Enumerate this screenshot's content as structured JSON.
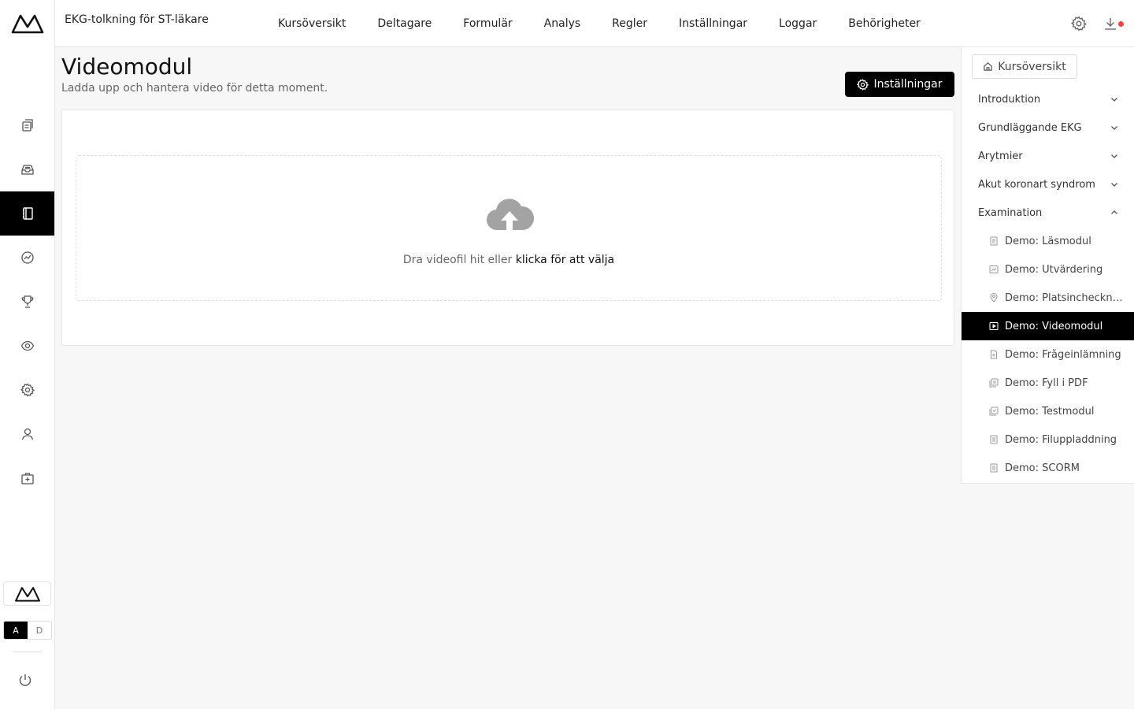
{
  "header": {
    "course_title": "EKG-tolkning för ST-läkare",
    "menu": [
      {
        "label": "Kursöversikt"
      },
      {
        "label": "Deltagare"
      },
      {
        "label": "Formulär"
      },
      {
        "label": "Analys"
      },
      {
        "label": "Regler"
      },
      {
        "label": "Inställningar"
      },
      {
        "label": "Loggar"
      },
      {
        "label": "Behörigheter"
      }
    ],
    "settings_icon": "gear-icon",
    "download_icon": "download-icon",
    "notification_color": "#ef4444"
  },
  "rail": {
    "active_index": 2,
    "items": [
      {
        "icon": "documents-icon"
      },
      {
        "icon": "inbox-icon"
      },
      {
        "icon": "notebook-icon"
      },
      {
        "icon": "analytics-icon"
      },
      {
        "icon": "trophy-icon"
      },
      {
        "icon": "eye-icon"
      },
      {
        "icon": "gear-icon"
      },
      {
        "icon": "user-icon"
      },
      {
        "icon": "medical-kit-icon"
      }
    ],
    "lang_a": "A",
    "lang_d": "D"
  },
  "main": {
    "title": "Videomodul",
    "subtitle": "Ladda upp och hantera video för detta moment.",
    "settings_button": "Inställningar",
    "dropzone_text": "Dra videofil hit eller ",
    "dropzone_link": "klicka för att välja"
  },
  "panel": {
    "overview_button": "Kursöversikt",
    "sections": [
      {
        "label": "Introduktion",
        "expanded": false
      },
      {
        "label": "Grundläggande EKG",
        "expanded": false
      },
      {
        "label": "Arytmier",
        "expanded": false
      },
      {
        "label": "Akut koronart syndrom",
        "expanded": false
      },
      {
        "label": "Examination",
        "expanded": true
      }
    ],
    "items": [
      {
        "label": "Demo: Läsmodul",
        "icon": "document-icon"
      },
      {
        "label": "Demo: Utvärdering",
        "icon": "chart-icon"
      },
      {
        "label": "Demo: Platsincheckning",
        "icon": "location-pin-icon"
      },
      {
        "label": "Demo: Videomodul",
        "icon": "video-icon",
        "active": true
      },
      {
        "label": "Demo: Frågeinlämning",
        "icon": "file-plus-icon"
      },
      {
        "label": "Demo: Fyll i PDF",
        "icon": "pdf-icon"
      },
      {
        "label": "Demo: Testmodul",
        "icon": "test-icon"
      },
      {
        "label": "Demo: Filuppladdning",
        "icon": "file-icon"
      },
      {
        "label": "Demo: SCORM",
        "icon": "file-icon"
      }
    ]
  }
}
